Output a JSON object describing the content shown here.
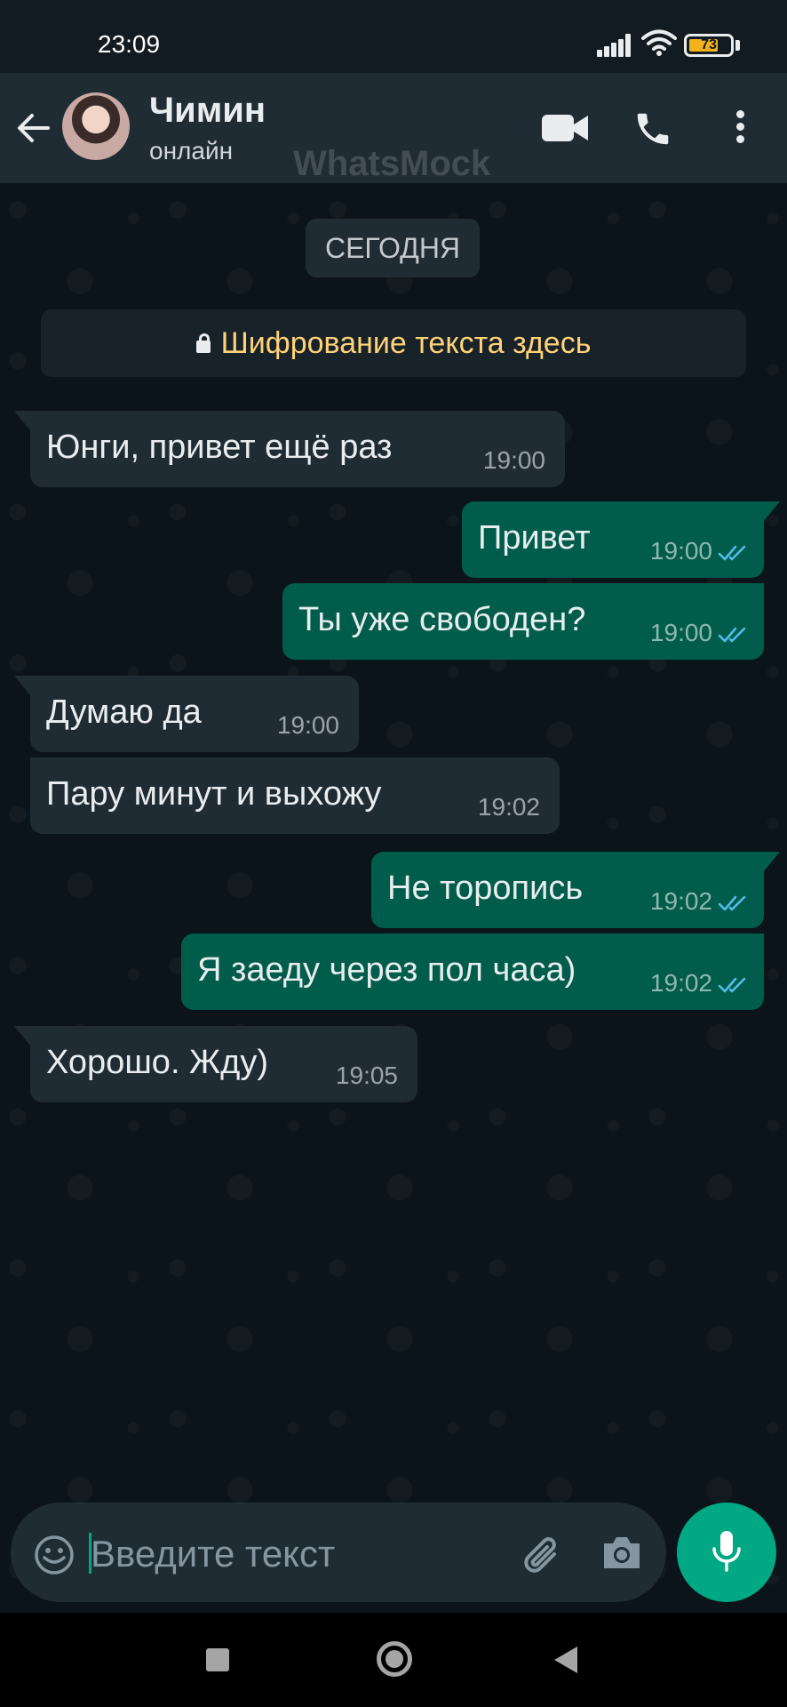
{
  "status_bar": {
    "time": "23:09",
    "battery_level": "73",
    "battery_fraction": 0.73
  },
  "header": {
    "contact_name": "Чимин",
    "contact_status": "онлайн",
    "watermark": "WhatsMock",
    "icons": [
      "back-arrow-icon",
      "video-call-icon",
      "phone-icon",
      "more-options-icon"
    ]
  },
  "chat": {
    "date_label": "СЕГОДНЯ",
    "encryption_notice": "Шифрование текста здесь",
    "messages": [
      {
        "direction": "incoming",
        "text": "Юнги, привет ещё раз",
        "time": "19:00"
      },
      {
        "direction": "outgoing",
        "text": "Привет",
        "time": "19:00",
        "status": "read"
      },
      {
        "direction": "outgoing",
        "text": "Ты уже свободен?",
        "time": "19:00",
        "status": "read"
      },
      {
        "direction": "incoming",
        "text": "Думаю да",
        "time": "19:00"
      },
      {
        "direction": "incoming",
        "text": "Пару минут и выхожу",
        "time": "19:02"
      },
      {
        "direction": "outgoing",
        "text": "Не торопись",
        "time": "19:02",
        "status": "read"
      },
      {
        "direction": "outgoing",
        "text": "Я заеду через пол часа)",
        "time": "19:02",
        "status": "read"
      },
      {
        "direction": "incoming",
        "text": "Хорошо. Жду)",
        "time": "19:05"
      }
    ]
  },
  "composer": {
    "placeholder": "Введите текст",
    "icons": [
      "emoji-icon",
      "attach-icon",
      "camera-icon",
      "mic-icon"
    ]
  },
  "colors": {
    "header_bg": "#1f2c34",
    "chat_bg": "#0b141a",
    "incoming_bubble": "#1f2c34",
    "outgoing_bubble": "#005c4b",
    "accent": "#00a884",
    "read_ticks": "#53bdeb",
    "encryption_text": "#ffd279"
  }
}
